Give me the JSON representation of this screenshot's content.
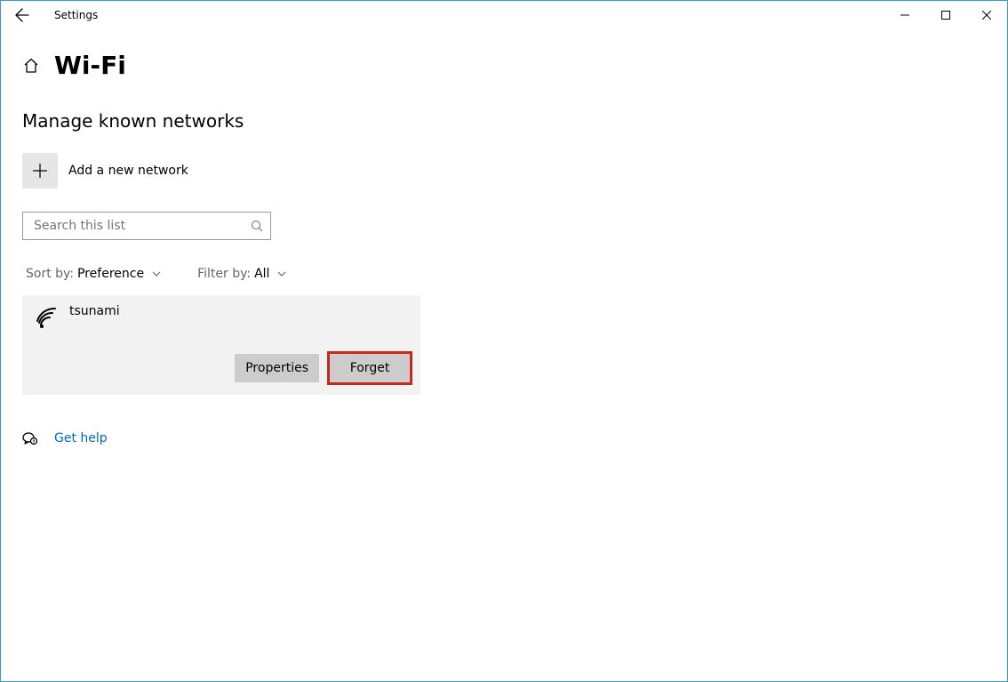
{
  "window": {
    "title": "Settings"
  },
  "page": {
    "title": "Wi-Fi",
    "section_title": "Manage known networks"
  },
  "add_network": {
    "label": "Add a new network"
  },
  "search": {
    "placeholder": "Search this list"
  },
  "sort": {
    "label": "Sort by:",
    "value": "Preference"
  },
  "filter": {
    "label": "Filter by:",
    "value": "All"
  },
  "network": {
    "name": "tsunami",
    "properties_label": "Properties",
    "forget_label": "Forget"
  },
  "help": {
    "label": "Get help"
  }
}
